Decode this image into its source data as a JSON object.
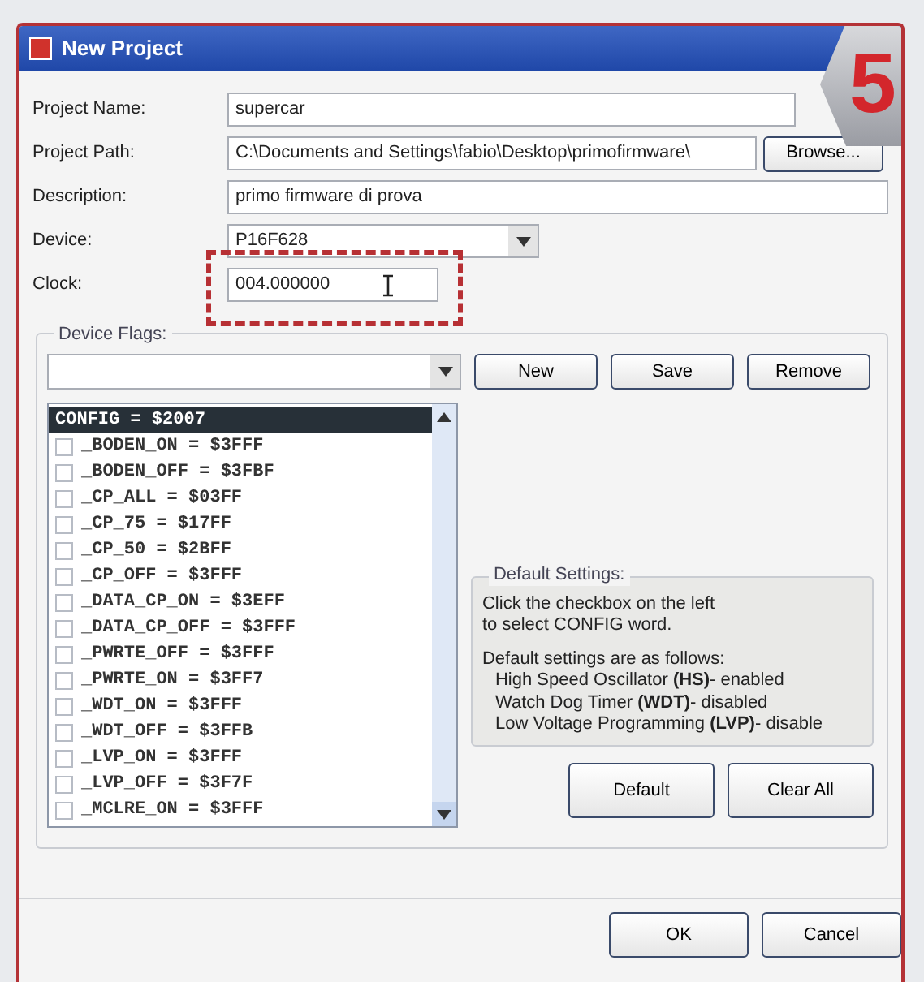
{
  "window": {
    "title": "New Project"
  },
  "step_badge": "5",
  "fields": [
    {
      "label": "Project Name:",
      "value": "supercar",
      "kind": "text"
    },
    {
      "label": "Project Path:",
      "value": "C:\\Documents and Settings\\fabio\\Desktop\\primofirmware\\",
      "kind": "path",
      "button": "Browse..."
    },
    {
      "label": "Description:",
      "value": "primo firmware di prova",
      "kind": "text"
    },
    {
      "label": "Device:",
      "value": "P16F628",
      "kind": "combo"
    },
    {
      "label": "Clock:",
      "value": "004.000000",
      "kind": "clock",
      "highlighted": true
    }
  ],
  "device_flags": {
    "title": "Device Flags:",
    "buttons": [
      "New",
      "Save",
      "Remove"
    ],
    "items": [
      {
        "text": "CONFIG = $2007",
        "kind": "word",
        "selected": true
      },
      {
        "text": "_BODEN_ON = $3FFF",
        "kind": "flag",
        "checked": false,
        "selected": false
      },
      {
        "text": "_BODEN_OFF = $3FBF",
        "kind": "flag",
        "checked": false,
        "selected": false
      },
      {
        "text": "_CP_ALL = $03FF",
        "kind": "flag",
        "checked": false,
        "selected": false
      },
      {
        "text": "_CP_75 = $17FF",
        "kind": "flag",
        "checked": false,
        "selected": false
      },
      {
        "text": "_CP_50 = $2BFF",
        "kind": "flag",
        "checked": false,
        "selected": false
      },
      {
        "text": "_CP_OFF = $3FFF",
        "kind": "flag",
        "checked": false,
        "selected": false
      },
      {
        "text": "_DATA_CP_ON = $3EFF",
        "kind": "flag",
        "checked": false,
        "selected": false
      },
      {
        "text": "_DATA_CP_OFF = $3FFF",
        "kind": "flag",
        "checked": false,
        "selected": false
      },
      {
        "text": "_PWRTE_OFF = $3FFF",
        "kind": "flag",
        "checked": false,
        "selected": false
      },
      {
        "text": "_PWRTE_ON = $3FF7",
        "kind": "flag",
        "checked": false,
        "selected": false
      },
      {
        "text": "_WDT_ON = $3FFF",
        "kind": "flag",
        "checked": false,
        "selected": false
      },
      {
        "text": "_WDT_OFF = $3FFB",
        "kind": "flag",
        "checked": false,
        "selected": false
      },
      {
        "text": "_LVP_ON = $3FFF",
        "kind": "flag",
        "checked": false,
        "selected": false
      },
      {
        "text": "_LVP_OFF = $3F7F",
        "kind": "flag",
        "checked": false,
        "selected": false
      },
      {
        "text": "_MCLRE_ON = $3FFF",
        "kind": "flag",
        "checked": false,
        "selected": false
      }
    ],
    "default_settings": {
      "title": "Default Settings:",
      "intro": [
        "Click the checkbox on the left",
        "to select CONFIG word."
      ],
      "summary": "Default settings are as follows:",
      "bullets": [
        "High Speed Oscillator **(HS)**- enabled",
        "Watch Dog Timer **(WDT)**- disabled",
        "Low Voltage Programming **(LVP)**- disable"
      ],
      "buttons": [
        "Default",
        "Clear All"
      ]
    }
  },
  "footer_buttons": [
    "OK",
    "Cancel"
  ]
}
